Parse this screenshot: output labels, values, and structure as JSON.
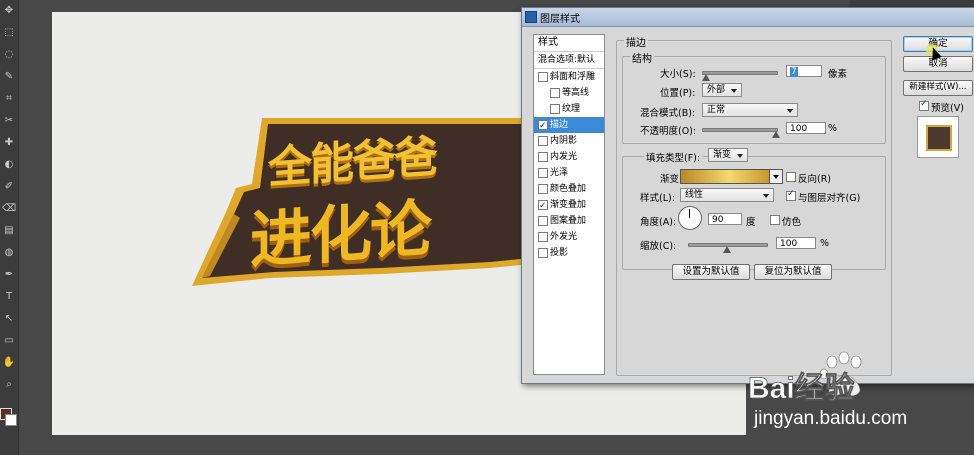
{
  "dialog": {
    "title": "图层样式",
    "styles_header": "样式",
    "blend_options": "混合选项:默认",
    "style_items": [
      {
        "label": "斜面和浮雕",
        "checked": false,
        "indent": false,
        "selected": false
      },
      {
        "label": "等高线",
        "checked": false,
        "indent": true,
        "selected": false
      },
      {
        "label": "纹理",
        "checked": false,
        "indent": true,
        "selected": false
      },
      {
        "label": "描边",
        "checked": true,
        "indent": false,
        "selected": true
      },
      {
        "label": "内阴影",
        "checked": false,
        "indent": false,
        "selected": false
      },
      {
        "label": "内发光",
        "checked": false,
        "indent": false,
        "selected": false
      },
      {
        "label": "光泽",
        "checked": false,
        "indent": false,
        "selected": false
      },
      {
        "label": "颜色叠加",
        "checked": false,
        "indent": false,
        "selected": false
      },
      {
        "label": "渐变叠加",
        "checked": true,
        "indent": false,
        "selected": false
      },
      {
        "label": "图案叠加",
        "checked": false,
        "indent": false,
        "selected": false
      },
      {
        "label": "外发光",
        "checked": false,
        "indent": false,
        "selected": false
      },
      {
        "label": "投影",
        "checked": false,
        "indent": false,
        "selected": false
      }
    ],
    "stroke": {
      "section_title": "描边",
      "structure_title": "结构",
      "size_label": "大小(S):",
      "size_value": "7",
      "size_unit": "像素",
      "size_fraction": 0.05,
      "position_label": "位置(P):",
      "position_value": "外部",
      "blend_mode_label": "混合模式(B):",
      "blend_mode_value": "正常",
      "opacity_label": "不透明度(O):",
      "opacity_value": "100",
      "opacity_unit": "%",
      "opacity_fraction": 1.0,
      "fill_type_label": "填充类型(F):",
      "fill_type_value": "渐变",
      "gradient_label": "渐变:",
      "reverse_label": "反向(R)",
      "reverse_checked": false,
      "style_label": "样式(L):",
      "style_value": "线性",
      "align_label": "与图层对齐(G)",
      "align_checked": true,
      "angle_label": "角度(A):",
      "angle_value": "90",
      "angle_unit": "度",
      "dither_label": "仿色",
      "dither_checked": false,
      "scale_label": "缩放(C):",
      "scale_value": "100",
      "scale_unit": "%",
      "scale_fraction": 0.5,
      "set_default": "设置为默认值",
      "reset_default": "复位为默认值"
    },
    "buttons": {
      "ok": "确定",
      "cancel": "取消",
      "new_style": "新建样式(W)...",
      "preview_label": "预览(V)",
      "preview_checked": true
    }
  },
  "canvas_art": {
    "line1": "全能爸爸",
    "line2": "进化论"
  },
  "watermark": {
    "brand": "Bai经验",
    "url": "jingyan.baidu.com"
  },
  "colors": {
    "accent": "#3a8ad8",
    "art_dark": "#3e2e26",
    "art_gold": "#f2c030"
  }
}
